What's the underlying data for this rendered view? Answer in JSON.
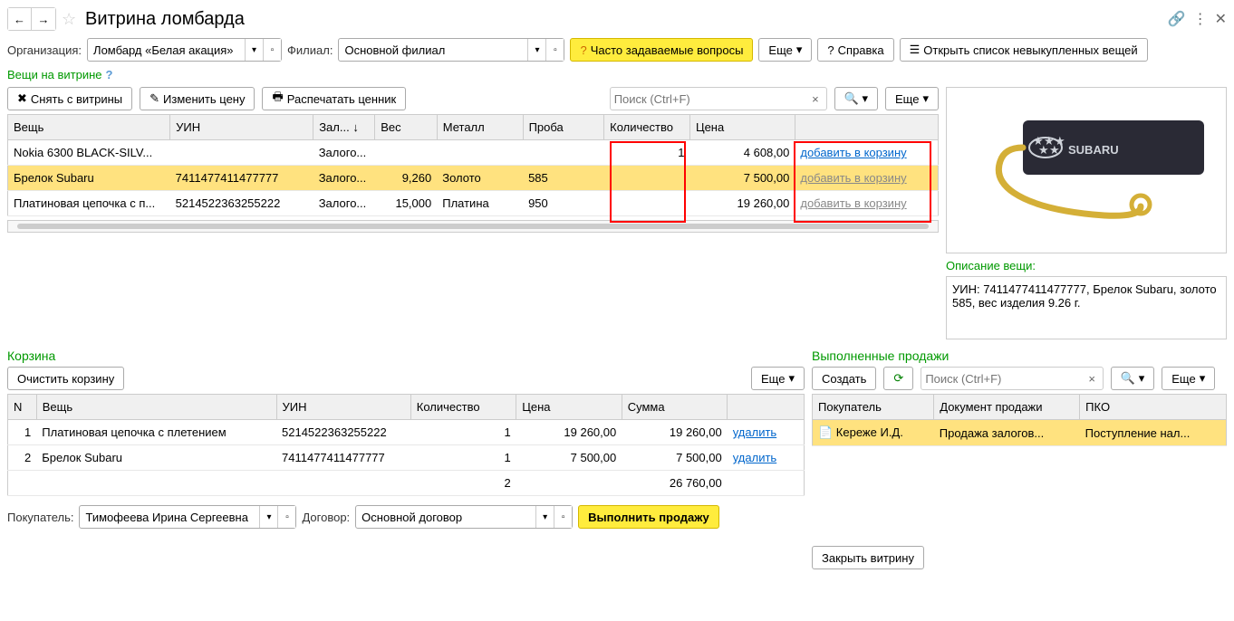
{
  "header": {
    "title": "Витрина ломбарда"
  },
  "org": {
    "label": "Организация:",
    "value": "Ломбард «Белая акация»"
  },
  "filial": {
    "label": "Филиал:",
    "value": "Основной филиал"
  },
  "buttons": {
    "faq": "Часто задаваемые вопросы",
    "more": "Еще",
    "help": "Справка",
    "open_list": "Открыть список невыкупленных вещей",
    "remove": "Снять с витрины",
    "change_price": "Изменить цену",
    "print_tag": "Распечатать ценник",
    "clear_cart": "Очистить корзину",
    "create": "Создать",
    "do_sale": "Выполнить продажу",
    "close_vitrine": "Закрыть витрину",
    "delete": "удалить",
    "add_cart": "добавить в корзину"
  },
  "search_placeholder": "Поиск (Ctrl+F)",
  "sections": {
    "vitrine": "Вещи на витрине",
    "cart": "Корзина",
    "sales": "Выполненные продажи",
    "desc": "Описание вещи:"
  },
  "vitrine_cols": [
    "Вещь",
    "УИН",
    "Зал...",
    "Вес",
    "Металл",
    "Проба",
    "Количество",
    "Цена",
    ""
  ],
  "vitrine_rows": [
    {
      "name": "Nokia 6300 BLACK-SILV...",
      "uin": "",
      "zal": "Залого...",
      "weight": "",
      "metal": "",
      "proba": "",
      "qty": "1",
      "price": "4 608,00",
      "link": "add",
      "gray": false
    },
    {
      "name": "Брелок Subaru",
      "uin": "7411477411477777",
      "zal": "Залого...",
      "weight": "9,260",
      "metal": "Золото",
      "proba": "585",
      "qty": "",
      "price": "7 500,00",
      "link": "add",
      "gray": true,
      "sel": true
    },
    {
      "name": "Платиновая цепочка с п...",
      "uin": "5214522363255222",
      "zal": "Залого...",
      "weight": "15,000",
      "metal": "Платина",
      "proba": "950",
      "qty": "",
      "price": "19 260,00",
      "link": "add",
      "gray": true
    }
  ],
  "desc_text": "УИН: 7411477411477777, Брелок Subaru, золото 585, вес изделия 9.26 г.",
  "cart_cols": [
    "N",
    "Вещь",
    "УИН",
    "Количество",
    "Цена",
    "Сумма",
    ""
  ],
  "cart_rows": [
    {
      "n": "1",
      "name": "Платиновая цепочка с плетением",
      "uin": "5214522363255222",
      "qty": "1",
      "price": "19 260,00",
      "sum": "19 260,00"
    },
    {
      "n": "2",
      "name": "Брелок Subaru",
      "uin": "7411477411477777",
      "qty": "1",
      "price": "7 500,00",
      "sum": "7 500,00"
    }
  ],
  "cart_total": {
    "qty": "2",
    "sum": "26 760,00"
  },
  "buyer": {
    "label": "Покупатель:",
    "value": "Тимофеева Ирина Сергеевна"
  },
  "contract": {
    "label": "Договор:",
    "value": "Основной договор"
  },
  "sales_cols": [
    "Покупатель",
    "Документ продажи",
    "ПКО"
  ],
  "sales_rows": [
    {
      "buyer": "Кереже И.Д.",
      "doc": "Продажа залогов...",
      "pko": "Поступление нал..."
    }
  ]
}
